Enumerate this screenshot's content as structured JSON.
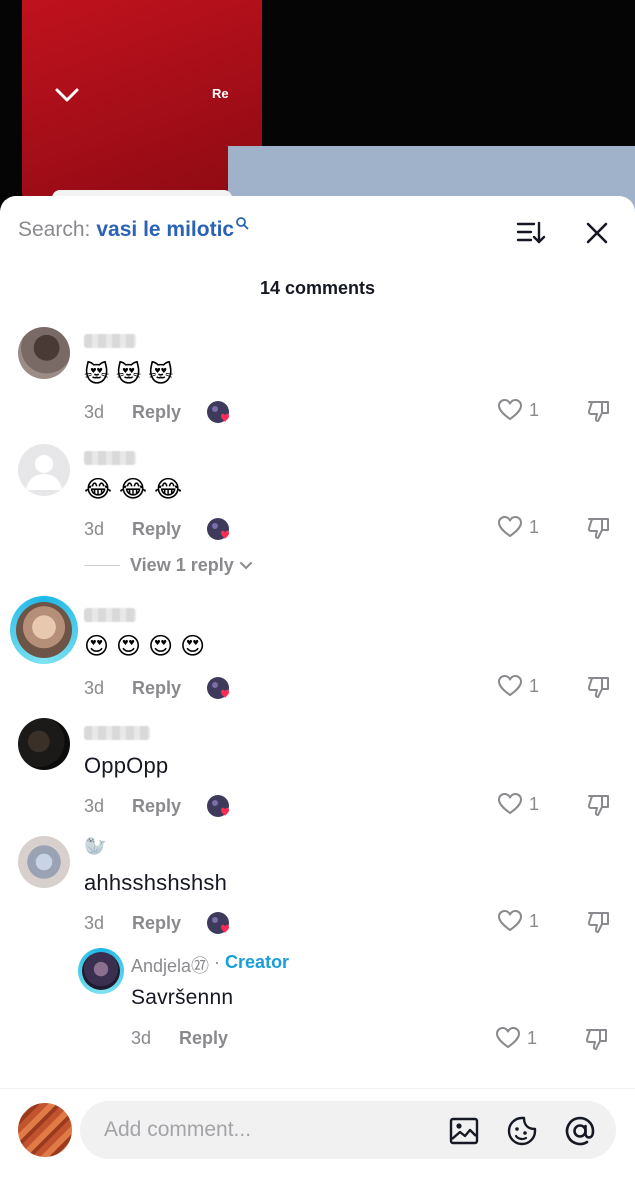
{
  "video": {
    "overlay_text": "Re"
  },
  "header": {
    "search_label": "Search:",
    "search_term": "vasi le milotic",
    "count_label": "14 comments"
  },
  "comments": [
    {
      "body_emoji": [
        "😻",
        "😻",
        "😻"
      ],
      "time": "3d",
      "reply_label": "Reply",
      "likes": "1"
    },
    {
      "body_emoji": [
        "😂",
        "😂",
        "😂"
      ],
      "time": "3d",
      "reply_label": "Reply",
      "likes": "1",
      "view_replies": "View 1 reply"
    },
    {
      "body_emoji": [
        "😍",
        "😍",
        "😍",
        "😍"
      ],
      "time": "3d",
      "reply_label": "Reply",
      "likes": "1"
    },
    {
      "body_text": "OppOpp",
      "time": "3d",
      "reply_label": "Reply",
      "likes": "1"
    },
    {
      "name_emoji": "🦭",
      "body_text": "ahhsshshshsh",
      "time": "3d",
      "reply_label": "Reply",
      "likes": "1",
      "reply": {
        "author": "Andjela㉗",
        "separator": "·",
        "creator_label": "Creator",
        "body_text": "Savršennn",
        "time": "3d",
        "reply_label": "Reply",
        "likes": "1"
      }
    }
  ],
  "bottom": {
    "placeholder": "Add comment..."
  },
  "colors": {
    "accent_blue": "#2a63b6",
    "creator_cyan": "#1a9fd8",
    "heart_red": "#fe2c55"
  }
}
